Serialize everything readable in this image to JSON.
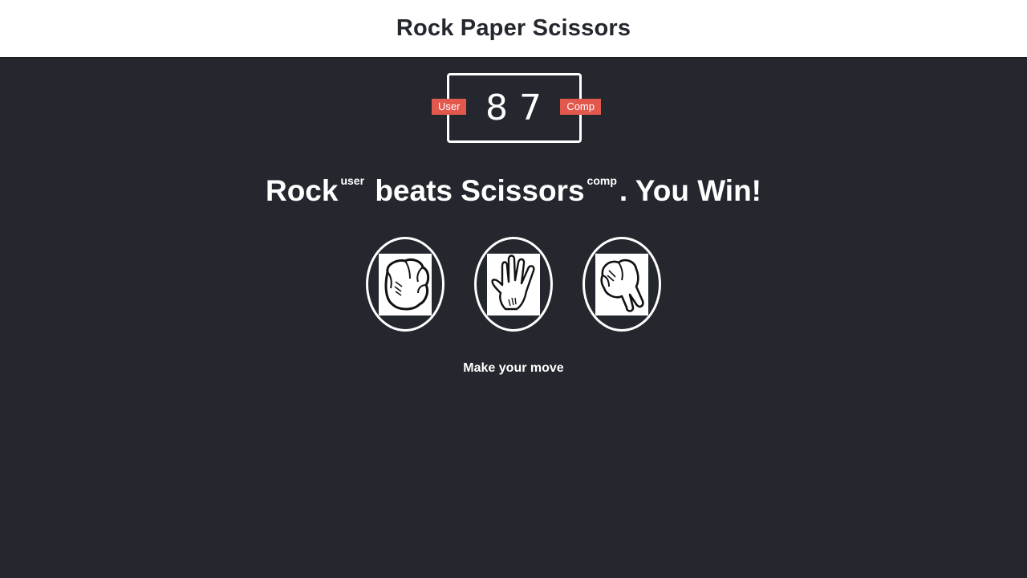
{
  "header": {
    "title": "Rock Paper Scissors"
  },
  "scoreboard": {
    "user_label": "User",
    "comp_label": "Comp",
    "user_score": "8",
    "comp_score": "7"
  },
  "result": {
    "user_choice": "Rock",
    "user_tag": "user",
    "verb": "beats",
    "comp_choice": "Scissors",
    "comp_tag": "comp",
    "outcome": ". You Win!"
  },
  "choices": [
    {
      "id": "rock",
      "icon": "rock-hand-icon"
    },
    {
      "id": "paper",
      "icon": "paper-hand-icon"
    },
    {
      "id": "scissors",
      "icon": "scissors-hand-icon"
    }
  ],
  "action_message": "Make your move",
  "colors": {
    "background": "#24272e",
    "header_bg": "#ffffff",
    "badge": "#e2584d",
    "text": "#ffffff"
  }
}
